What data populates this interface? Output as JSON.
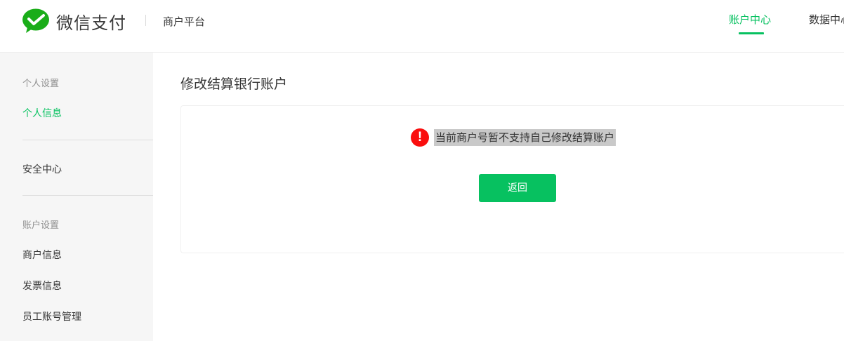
{
  "header": {
    "brand": "微信支付",
    "platform": "商户平台",
    "nav": [
      {
        "label": "账户中心",
        "active": true
      },
      {
        "label": "数据中心",
        "active": false
      }
    ]
  },
  "sidebar": {
    "groups": [
      {
        "title": "个人设置",
        "items": [
          {
            "label": "个人信息",
            "active": true
          }
        ]
      },
      {
        "title": "",
        "items": [
          {
            "label": "安全中心",
            "active": false
          }
        ]
      },
      {
        "title": "账户设置",
        "items": [
          {
            "label": "商户信息",
            "active": false
          },
          {
            "label": "发票信息",
            "active": false
          },
          {
            "label": "员工账号管理",
            "active": false
          }
        ]
      }
    ]
  },
  "main": {
    "title": "修改结算银行账户",
    "alert": {
      "icon": "exclamation-icon",
      "message": "当前商户号暂不支持自己修改结算账户"
    },
    "back_button": "返回"
  },
  "colors": {
    "accent": "#07c160",
    "alert": "#fa0e0e",
    "sidebar_bg": "#f6f6f6",
    "highlight": "#c9c9c9"
  }
}
